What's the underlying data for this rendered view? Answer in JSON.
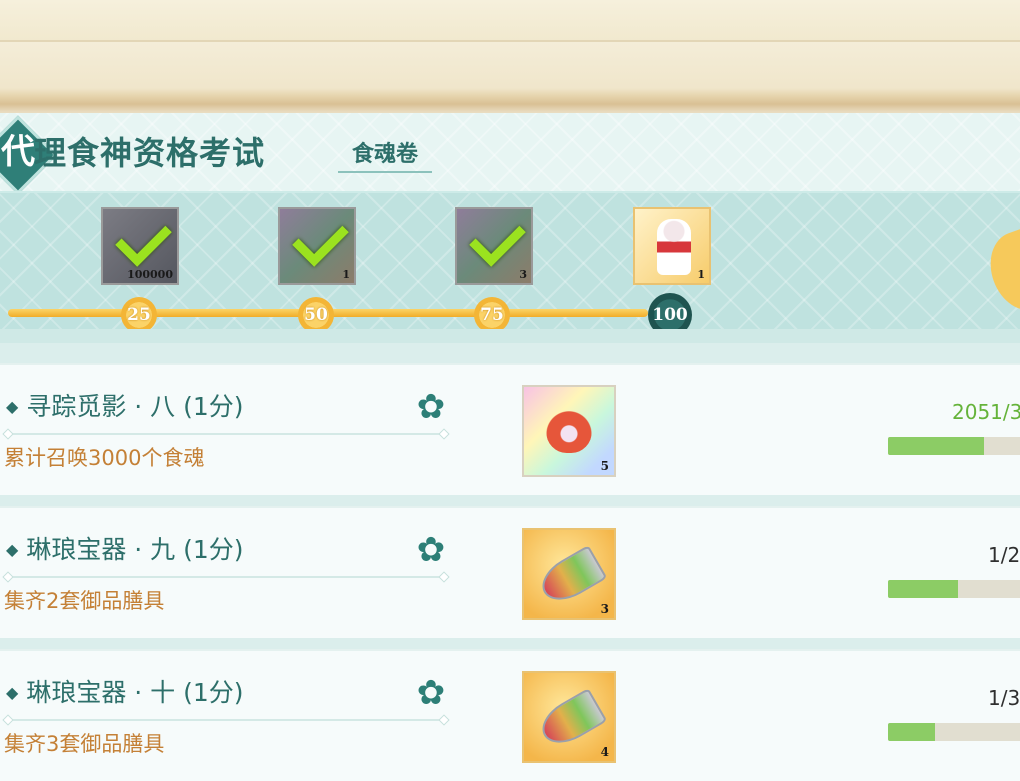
{
  "header": {
    "icon_char": "代",
    "title": "理食神资格考试",
    "subtitle": "食魂卷"
  },
  "tiers": [
    {
      "count": "100000",
      "claimed": true,
      "milestone": "25",
      "icon": "coin-pouch-icon"
    },
    {
      "count": "1",
      "claimed": true,
      "milestone": "50",
      "icon": "fire-spirit-icon"
    },
    {
      "count": "3",
      "claimed": true,
      "milestone": "75",
      "icon": "fire-spirit-icon"
    },
    {
      "count": "1",
      "claimed": false,
      "milestone": "100",
      "icon": "character-portrait-icon"
    }
  ],
  "tasks": [
    {
      "name": "寻踪觅影 · 八 (1分)",
      "desc": "累计召唤3000个食魂",
      "reward_count": "5",
      "reward_icon": "fire-spirit-icon",
      "progress_text": "2051/3",
      "progress_fraction": 0.6837
    },
    {
      "name": "琳琅宝器 · 九 (1分)",
      "desc": "集齐2套御品膳具",
      "reward_count": "3",
      "reward_icon": "spice-bottle-icon",
      "progress_text": "1/2",
      "progress_fraction": 0.5
    },
    {
      "name": "琳琅宝器 · 十 (1分)",
      "desc": "集齐3套御品膳具",
      "reward_count": "4",
      "reward_icon": "spice-bottle-icon",
      "progress_text": "1/3",
      "progress_fraction": 0.3333
    }
  ],
  "colors": {
    "accent_teal": "#2d6f6a",
    "desc_orange": "#c48036",
    "progress_green": "#8ccc65",
    "milestone_gold": "#f3b536"
  }
}
